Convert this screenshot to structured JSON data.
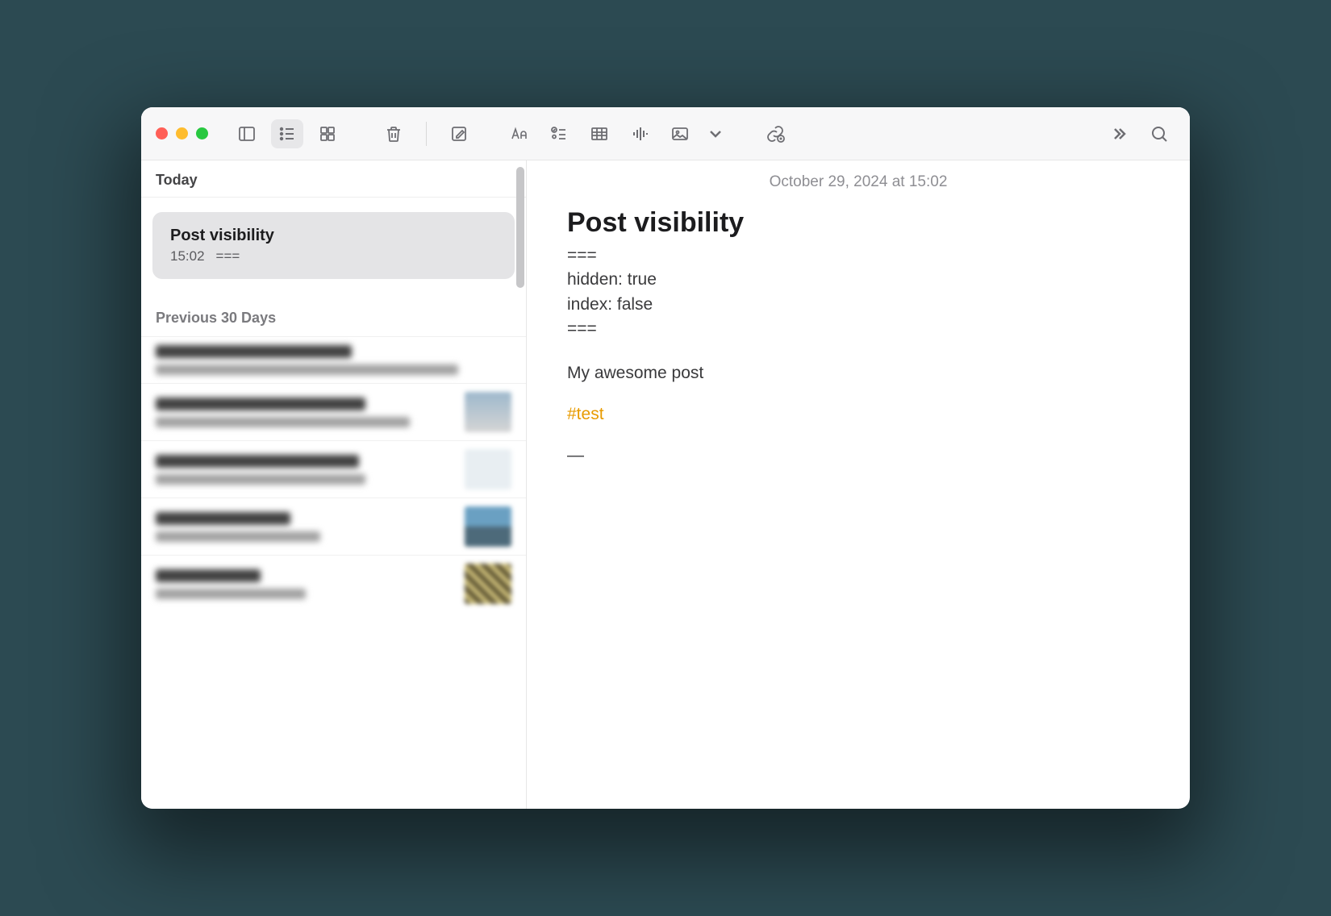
{
  "sidebar": {
    "section_today": "Today",
    "section_prev30": "Previous 30 Days",
    "selected": {
      "title": "Post visibility",
      "time": "15:02",
      "preview": "==="
    }
  },
  "editor": {
    "timestamp": "October 29, 2024 at 15:02",
    "title": "Post visibility",
    "line_sep1": "===",
    "line_hidden": "hidden: true",
    "line_index": "index: false",
    "line_sep2": "===",
    "body": "My awesome post",
    "tag": "#test",
    "dash": "—"
  }
}
